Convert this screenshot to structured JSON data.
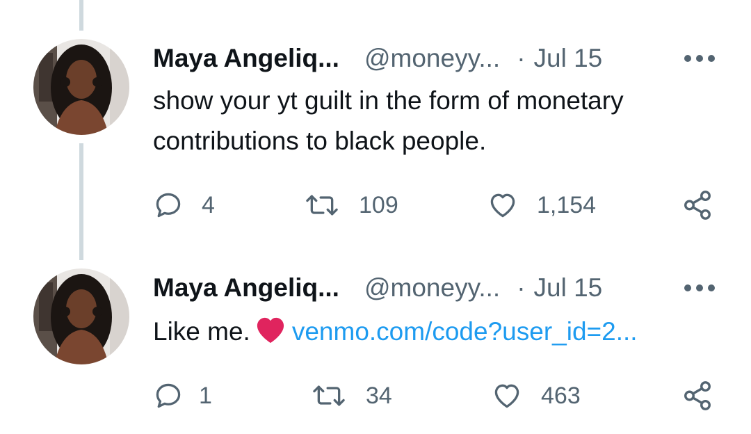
{
  "tweets": [
    {
      "author_name": "Maya Angeliq...",
      "handle": "@moneyy...",
      "separator": "·",
      "date": "Jul 15",
      "text_line1": "show your yt guilt in the form of monetary",
      "text_line2": "contributions to black people.",
      "replies": "4",
      "retweets": "109",
      "likes": "1,154"
    },
    {
      "author_name": "Maya Angeliq...",
      "handle": "@moneyy...",
      "separator": "·",
      "date": "Jul 15",
      "text": "Like me.",
      "link": "venmo.com/code?user_id=2...",
      "replies": "1",
      "retweets": "34",
      "likes": "463"
    }
  ],
  "colors": {
    "primary_text": "#0f1419",
    "secondary_text": "#536471",
    "link": "#1d9bf0",
    "thread_line": "#cfd9de",
    "emoji_heart": "#e0245e"
  },
  "icons": [
    "more-icon",
    "reply-icon",
    "retweet-icon",
    "like-icon",
    "share-icon",
    "red-heart-emoji"
  ]
}
